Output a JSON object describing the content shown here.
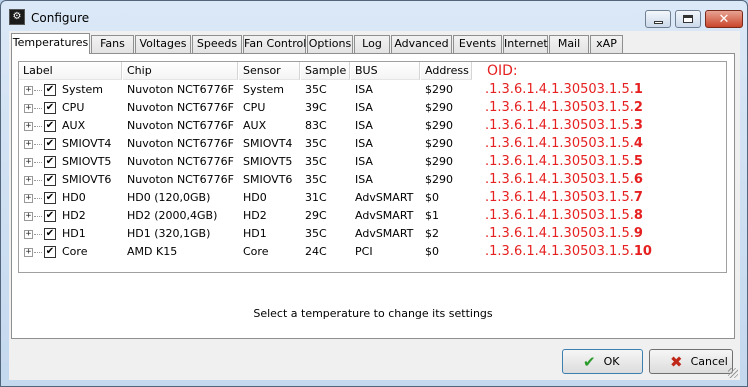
{
  "window": {
    "title": "Configure",
    "buttons": {
      "minimize": "minimize",
      "maximize": "maximize",
      "close": "close"
    }
  },
  "tabs": [
    {
      "label": "Temperatures",
      "active": true
    },
    {
      "label": "Fans"
    },
    {
      "label": "Voltages"
    },
    {
      "label": "Speeds"
    },
    {
      "label": "Fan Control"
    },
    {
      "label": "Options"
    },
    {
      "label": "Log"
    },
    {
      "label": "Advanced"
    },
    {
      "label": "Events"
    },
    {
      "label": "Internet"
    },
    {
      "label": "Mail"
    },
    {
      "label": "xAP"
    }
  ],
  "table": {
    "columns": [
      "Label",
      "Chip",
      "Sensor",
      "Sample",
      "BUS",
      "Address"
    ],
    "oid_header": "OID:",
    "rows": [
      {
        "label": "System",
        "chip": "Nuvoton NCT6776F",
        "sensor": "System",
        "sample": "35C",
        "bus": "ISA",
        "address": "$290",
        "oid_prefix": ".1.3.6.1.4.1.30503.1.5.",
        "oid_suffix": "1"
      },
      {
        "label": "CPU",
        "chip": "Nuvoton NCT6776F",
        "sensor": "CPU",
        "sample": "39C",
        "bus": "ISA",
        "address": "$290",
        "oid_prefix": ".1.3.6.1.4.1.30503.1.5.",
        "oid_suffix": "2"
      },
      {
        "label": "AUX",
        "chip": "Nuvoton NCT6776F",
        "sensor": "AUX",
        "sample": "83C",
        "bus": "ISA",
        "address": "$290",
        "oid_prefix": ".1.3.6.1.4.1.30503.1.5.",
        "oid_suffix": "3"
      },
      {
        "label": "SMIOVT4",
        "chip": "Nuvoton NCT6776F",
        "sensor": "SMIOVT4",
        "sample": "35C",
        "bus": "ISA",
        "address": "$290",
        "oid_prefix": ".1.3.6.1.4.1.30503.1.5.",
        "oid_suffix": "4"
      },
      {
        "label": "SMIOVT5",
        "chip": "Nuvoton NCT6776F",
        "sensor": "SMIOVT5",
        "sample": "35C",
        "bus": "ISA",
        "address": "$290",
        "oid_prefix": ".1.3.6.1.4.1.30503.1.5.",
        "oid_suffix": "5"
      },
      {
        "label": "SMIOVT6",
        "chip": "Nuvoton NCT6776F",
        "sensor": "SMIOVT6",
        "sample": "35C",
        "bus": "ISA",
        "address": "$290",
        "oid_prefix": ".1.3.6.1.4.1.30503.1.5.",
        "oid_suffix": "6"
      },
      {
        "label": "HD0",
        "chip": "HD0 (120,0GB)",
        "sensor": "HD0",
        "sample": "31C",
        "bus": "AdvSMART",
        "address": "$0",
        "oid_prefix": ".1.3.6.1.4.1.30503.1.5.",
        "oid_suffix": "7"
      },
      {
        "label": "HD2",
        "chip": "HD2 (2000,4GB)",
        "sensor": "HD2",
        "sample": "29C",
        "bus": "AdvSMART",
        "address": "$1",
        "oid_prefix": ".1.3.6.1.4.1.30503.1.5.",
        "oid_suffix": "8"
      },
      {
        "label": "HD1",
        "chip": "HD1 (320,1GB)",
        "sensor": "HD1",
        "sample": "35C",
        "bus": "AdvSMART",
        "address": "$2",
        "oid_prefix": ".1.3.6.1.4.1.30503.1.5.",
        "oid_suffix": "9"
      },
      {
        "label": "Core",
        "chip": "AMD K15",
        "sensor": "Core",
        "sample": "24C",
        "bus": "PCI",
        "address": "$0",
        "oid_prefix": ".1.3.6.1.4.1.30503.1.5.",
        "oid_suffix": "10"
      }
    ]
  },
  "hint": "Select a temperature to change its settings",
  "buttons": {
    "ok": "OK",
    "cancel": "Cancel"
  },
  "colors": {
    "oid": "#e62020",
    "ok_icon": "#2a9a2a",
    "cancel_icon": "#c0281a"
  },
  "icons": {
    "expander": "+",
    "check": "✔",
    "ok": "✔",
    "cancel": "✖"
  }
}
